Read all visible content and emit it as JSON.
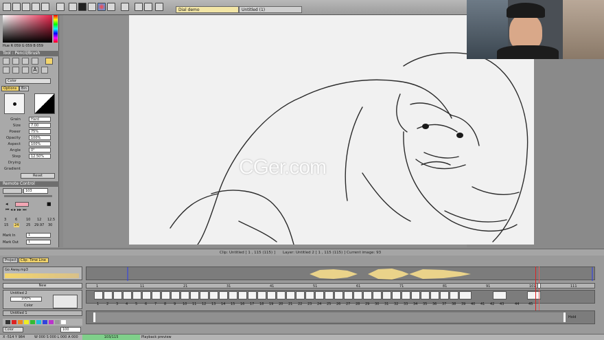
{
  "tabs": [
    {
      "label": "Dial demo"
    },
    {
      "label": "Untitled (1)"
    }
  ],
  "color_panel": {
    "readout": "Hue R 059 G 059 B 059"
  },
  "tool": {
    "title": "Tool : Pencil/Brush",
    "color_select": "Color"
  },
  "options": {
    "tabs": [
      "Options",
      "Bin"
    ],
    "rows": [
      {
        "label": "Grain",
        "value": "Hard"
      },
      {
        "label": "Size",
        "value": "7.00"
      },
      {
        "label": "Power",
        "value": "75%"
      },
      {
        "label": "Opacity",
        "value": "100%"
      },
      {
        "label": "Aspect",
        "value": "100%"
      },
      {
        "label": "Angle",
        "value": "0°"
      },
      {
        "label": "Step",
        "value": "12.50%"
      },
      {
        "label": "Drying",
        "value": ""
      },
      {
        "label": "Gradient",
        "value": ""
      }
    ],
    "reset": "Reset"
  },
  "remote": {
    "title": "Remote Control",
    "frame": "103",
    "fps_top": [
      "3",
      "6",
      "10",
      "12",
      "12.5"
    ],
    "fps_bottom": [
      "15",
      "24",
      "25",
      "29.97",
      "30"
    ],
    "mark_in_label": "Mark In",
    "mark_in": "1",
    "mark_out_label": "Mark Out",
    "mark_out": "1"
  },
  "status": {
    "clip": "Clip: Untitled [ 1 , 115  (115) ]",
    "layer": "Layer: Untitled 2 [ 1 , 115  (115) ]",
    "image": "Current image: 93"
  },
  "panel_tabs": [
    "Project",
    "Clip: Time Line"
  ],
  "audio_track": {
    "name": "Go Away.mp3"
  },
  "layers": [
    {
      "name": "Untitled 2",
      "opacity": "100%",
      "mode": "Color"
    },
    {
      "name": "Untitled 1"
    }
  ],
  "new_button": "New",
  "ruler": [
    "1",
    "11",
    "21",
    "31",
    "41",
    "51",
    "61",
    "71",
    "81",
    "91",
    "101",
    "111"
  ],
  "frame_numbers": [
    "1",
    "2",
    "3",
    "4",
    "5",
    "6",
    "7",
    "8",
    "9",
    "10",
    "11",
    "12",
    "13",
    "14",
    "15",
    "16",
    "17",
    "18",
    "19",
    "20",
    "21",
    "22",
    "23",
    "24",
    "25",
    "26",
    "27",
    "28",
    "29",
    "30",
    "31",
    "32",
    "33",
    "34",
    "35",
    "36",
    "37",
    "38",
    "39",
    "40",
    "41",
    "42",
    "43",
    "44",
    "45"
  ],
  "hold_label": "Hold",
  "footer": {
    "coords": "X -514  Y 984",
    "size": "W 000 S 000  L 000 A 000",
    "frames": "103/115",
    "mode": "Playback preview",
    "color_select": "Color",
    "value": "100"
  },
  "watermark": "CGer.com"
}
